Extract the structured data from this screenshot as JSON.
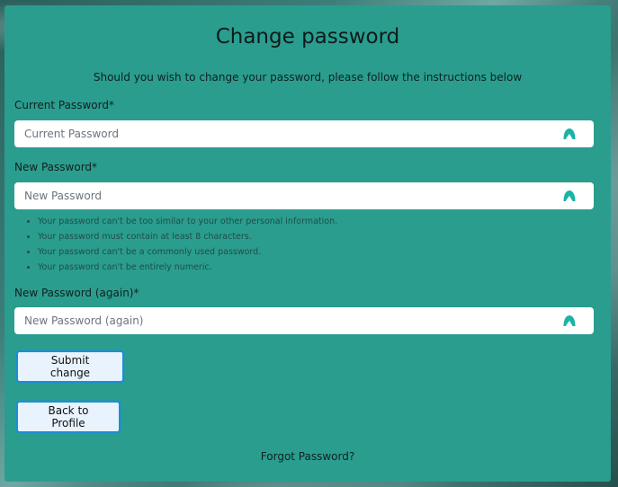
{
  "page": {
    "title": "Change password",
    "subtitle": "Should you wish to change your password, please follow the instructions below"
  },
  "form": {
    "current_password": {
      "label": "Current Password*",
      "placeholder": "Current Password",
      "value": ""
    },
    "new_password": {
      "label": "New Password*",
      "placeholder": "New Password",
      "value": ""
    },
    "password_hints": [
      "Your password can't be too similar to your other personal information.",
      "Your password must contain at least 8 characters.",
      "Your password can't be a commonly used password.",
      "Your password can't be entirely numeric."
    ],
    "new_password_again": {
      "label": "New Password (again)*",
      "placeholder": "New Password (again)",
      "value": ""
    }
  },
  "actions": {
    "submit_label": "Submit change",
    "back_label": "Back to Profile",
    "forgot_label": "Forgot Password?"
  },
  "icons": {
    "password_manager": "password-manager-icon"
  },
  "colors": {
    "panel_bg": "#2a9d8f",
    "icon_accent": "#1ab3a6",
    "button_border": "#1a8fd6",
    "button_bg": "#e8f3fd"
  }
}
